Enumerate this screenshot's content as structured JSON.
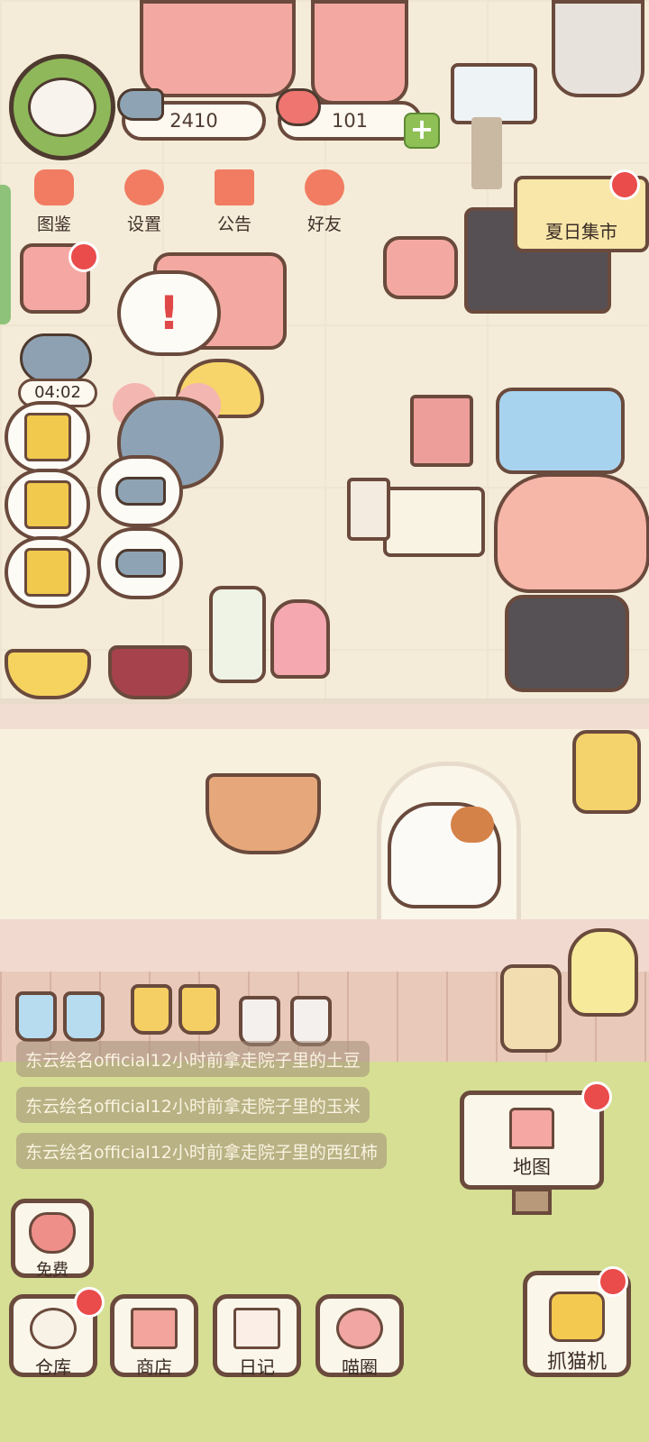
{
  "hud": {
    "fish_currency": "2410",
    "heart_currency": "101",
    "plus_symbol": "+"
  },
  "top_menu": [
    {
      "label": "图鉴",
      "icon": "cat-head-icon"
    },
    {
      "label": "设置",
      "icon": "gear-icon"
    },
    {
      "label": "公告",
      "icon": "gift-icon"
    },
    {
      "label": "好友",
      "icon": "friends-icon"
    }
  ],
  "event_sign": {
    "label": "夏日集市"
  },
  "timer": {
    "value": "04:02"
  },
  "alert_symbol": "!",
  "activity_log": [
    "东云绘名official12小时前拿走院子里的土豆",
    "东云绘名official12小时前拿走院子里的玉米",
    "东云绘名official12小时前拿走院子里的西红柿"
  ],
  "map_button": {
    "label": "地图",
    "icon": "house-icon"
  },
  "free_button": {
    "label": "免费",
    "icon": "heart-icon"
  },
  "bottom_nav": [
    {
      "label": "仓库",
      "icon": "storage-icon",
      "badge": true
    },
    {
      "label": "商店",
      "icon": "shop-icon",
      "badge": false
    },
    {
      "label": "日记",
      "icon": "diary-icon",
      "badge": false
    },
    {
      "label": "喵圈",
      "icon": "cat-planet-icon",
      "badge": false
    }
  ],
  "claw_button": {
    "label": "抓猫机",
    "icon": "claw-icon"
  },
  "colors": {
    "badge_red": "#ea4b4b",
    "outline_brown": "#6a4a3c",
    "grass_green": "#d6df93",
    "accent_coral": "#f17c62"
  }
}
